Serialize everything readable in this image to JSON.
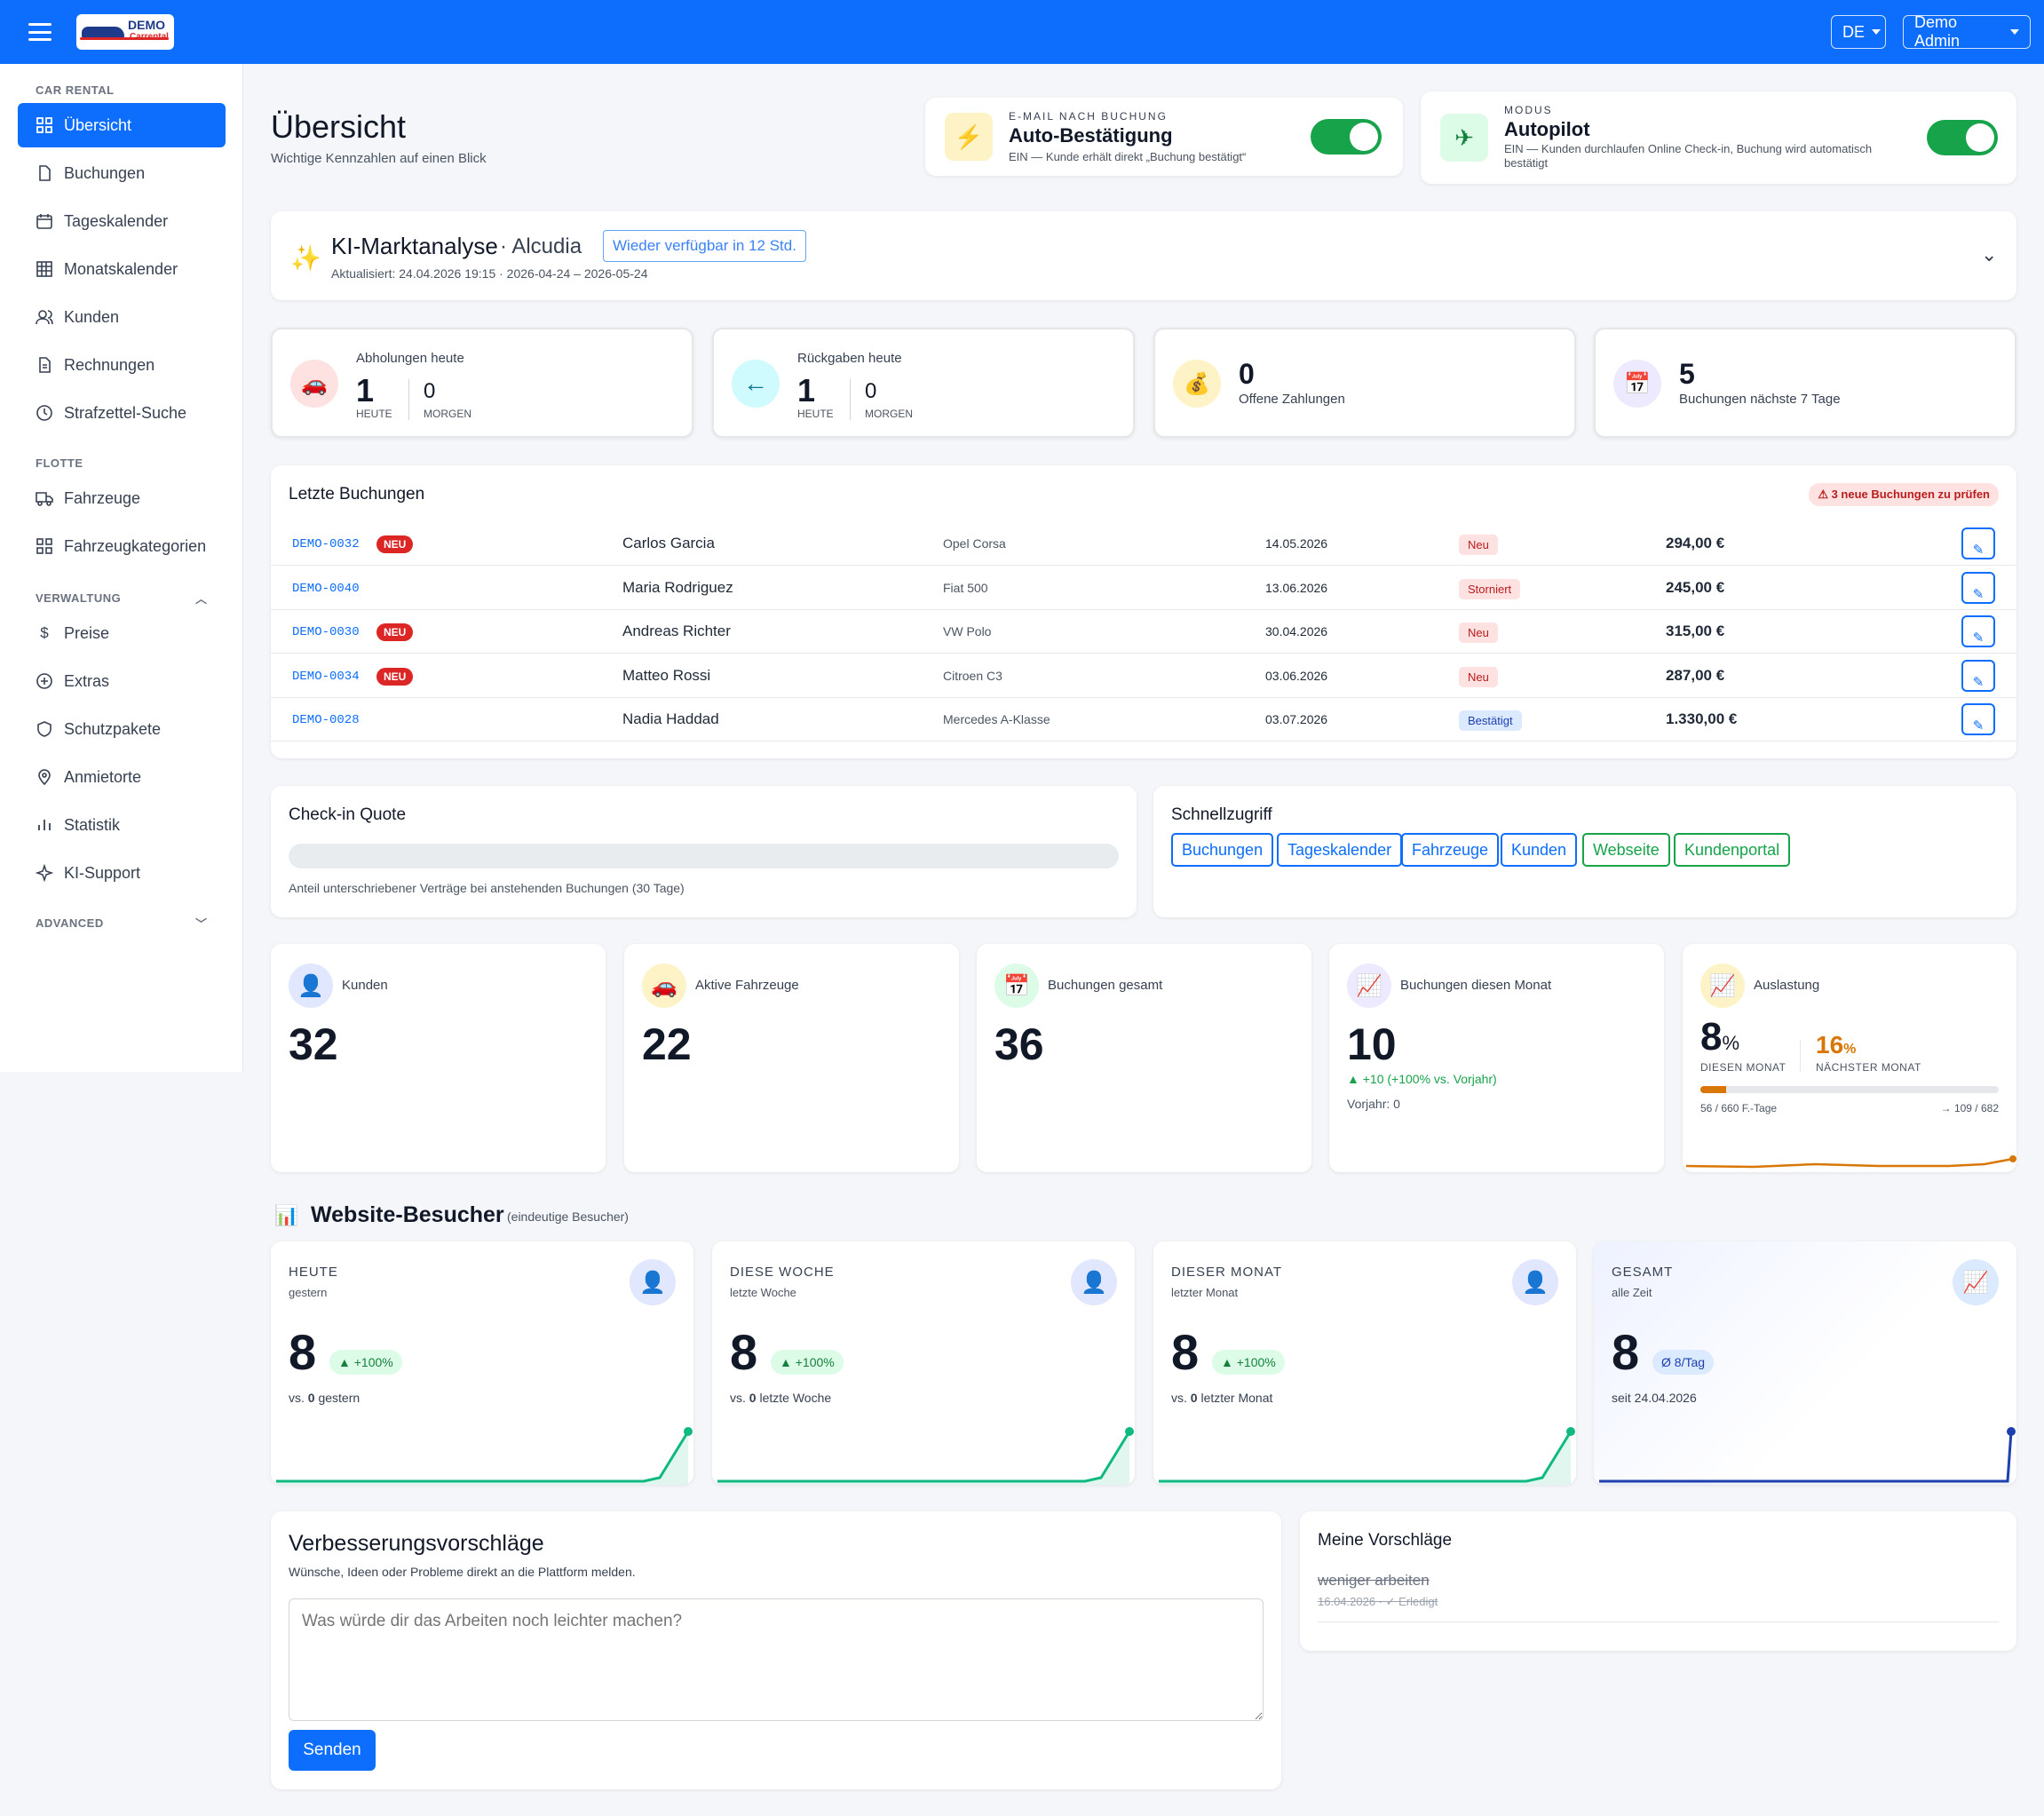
{
  "topbar": {
    "lang": "DE",
    "user": "Demo Admin",
    "logo_title": "DEMO",
    "logo_sub": "Carrental"
  },
  "sidebar": {
    "section_car_rental": "CAR RENTAL",
    "section_flotte": "FLOTTE",
    "section_verwaltung": "VERWALTUNG",
    "section_advanced": "ADVANCED",
    "items": [
      {
        "label": "Übersicht",
        "icon": "grid-icon"
      },
      {
        "label": "Buchungen",
        "icon": "file-icon"
      },
      {
        "label": "Tageskalender",
        "icon": "calendar-icon"
      },
      {
        "label": "Monatskalender",
        "icon": "table-icon"
      },
      {
        "label": "Kunden",
        "icon": "users-icon"
      },
      {
        "label": "Rechnungen",
        "icon": "invoice-icon"
      },
      {
        "label": "Strafzettel-Suche",
        "icon": "clock-icon"
      },
      {
        "label": "Fahrzeuge",
        "icon": "truck-icon"
      },
      {
        "label": "Fahrzeugkategorien",
        "icon": "grid-icon"
      },
      {
        "label": "Preise",
        "icon": "dollar-icon"
      },
      {
        "label": "Extras",
        "icon": "plus-circle-icon"
      },
      {
        "label": "Schutzpakete",
        "icon": "shield-icon"
      },
      {
        "label": "Anmietorte",
        "icon": "map-pin-icon"
      },
      {
        "label": "Statistik",
        "icon": "bar-chart-icon"
      },
      {
        "label": "KI-Support",
        "icon": "sparkle-icon"
      }
    ]
  },
  "header": {
    "title": "Übersicht",
    "subtitle": "Wichtige Kennzahlen auf einen Blick"
  },
  "auto_confirm": {
    "kicker": "E-MAIL NACH BUCHUNG",
    "title": "Auto-Bestätigung",
    "desc": "EIN — Kunde erhält direkt „Buchung bestätigt“",
    "enabled": true
  },
  "autopilot": {
    "kicker": "MODUS",
    "title": "Autopilot",
    "desc": "EIN — Kunden durchlaufen Online Check-in, Buchung wird automatisch bestätigt",
    "enabled": true
  },
  "ki": {
    "title": "KI-Marktanalyse",
    "location": "· Alcudia",
    "button": "Wieder verfügbar in 12 Std.",
    "updated": "Aktualisiert: 24.04.2026 19:15 · 2026-04-24 – 2026-05-24"
  },
  "stats": {
    "pickups": {
      "label": "Abholungen heute",
      "today": "1",
      "today_label": "HEUTE",
      "tomorrow": "0",
      "tomorrow_label": "MORGEN"
    },
    "returns": {
      "label": "Rückgaben heute",
      "today": "1",
      "today_label": "HEUTE",
      "tomorrow": "0",
      "tomorrow_label": "MORGEN"
    },
    "payments": {
      "value": "0",
      "label": "Offene Zahlungen"
    },
    "next7": {
      "value": "5",
      "label": "Buchungen nächste 7 Tage"
    }
  },
  "bookings": {
    "title": "Letzte Buchungen",
    "alert": "⚠ 3 neue Buchungen zu prüfen",
    "new_label": "NEU",
    "rows": [
      {
        "id": "DEMO-0032",
        "new": true,
        "customer": "Carlos Garcia",
        "car": "Opel Corsa",
        "date": "14.05.2026",
        "status": "Neu",
        "price": "294,00 €"
      },
      {
        "id": "DEMO-0040",
        "new": false,
        "customer": "Maria Rodriguez",
        "car": "Fiat 500",
        "date": "13.06.2026",
        "status": "Storniert",
        "price": "245,00 €"
      },
      {
        "id": "DEMO-0030",
        "new": true,
        "customer": "Andreas Richter",
        "car": "VW Polo",
        "date": "30.04.2026",
        "status": "Neu",
        "price": "315,00 €"
      },
      {
        "id": "DEMO-0034",
        "new": true,
        "customer": "Matteo Rossi",
        "car": "Citroen C3",
        "date": "03.06.2026",
        "status": "Neu",
        "price": "287,00 €"
      },
      {
        "id": "DEMO-0028",
        "new": false,
        "customer": "Nadia Haddad",
        "car": "Mercedes A-Klasse",
        "date": "03.07.2026",
        "status": "Bestätigt",
        "price": "1.330,00 €"
      }
    ]
  },
  "checkin": {
    "title": "Check-in Quote",
    "note": "Anteil unterschriebener Verträge bei anstehenden Buchungen (30 Tage)",
    "progress": 0
  },
  "quick": {
    "title": "Schnellzugriff",
    "links": [
      "Buchungen",
      "Tageskalender",
      "Fahrzeuge",
      "Kunden",
      "Webseite",
      "Kundenportal"
    ]
  },
  "kpis": {
    "customers": {
      "label": "Kunden",
      "value": "32"
    },
    "vehicles": {
      "label": "Aktive Fahrzeuge",
      "value": "22"
    },
    "bookings_total": {
      "label": "Buchungen gesamt",
      "value": "36"
    },
    "bookings_month": {
      "label": "Buchungen diesen Monat",
      "value": "10",
      "delta": "▲ +10 (+100% vs. Vorjahr)",
      "prev": "Vorjahr: 0"
    },
    "utilization": {
      "label": "Auslastung",
      "value": "8",
      "unit": "%",
      "value_label": "DIESEN MONAT",
      "next": "16",
      "next_unit": "%",
      "next_label": "NÄCHSTER MONAT",
      "days": "56 / 660 F.-Tage",
      "next_days": "→ 109 / 682",
      "progress": 0.085
    }
  },
  "visitors": {
    "title": "Website-Besucher",
    "subtitle": "(eindeutige Besucher)",
    "cards": [
      {
        "label": "HEUTE",
        "sub": "gestern",
        "value": "8",
        "badge": "▲ +100%",
        "vs_prefix": "vs.",
        "vs_value": "0",
        "vs_suffix": "gestern"
      },
      {
        "label": "DIESE WOCHE",
        "sub": "letzte Woche",
        "value": "8",
        "badge": "▲ +100%",
        "vs_prefix": "vs.",
        "vs_value": "0",
        "vs_suffix": "letzte Woche"
      },
      {
        "label": "DIESER MONAT",
        "sub": "letzter Monat",
        "value": "8",
        "badge": "▲ +100%",
        "vs_prefix": "vs.",
        "vs_value": "0",
        "vs_suffix": "letzter Monat"
      },
      {
        "label": "GESAMT",
        "sub": "alle Zeit",
        "value": "8",
        "badge": "Ø 8/Tag",
        "since": "seit 24.04.2026"
      }
    ]
  },
  "feedback": {
    "title": "Verbesserungsvorschläge",
    "subtitle": "Wünsche, Ideen oder Probleme direkt an die Plattform melden.",
    "placeholder": "Was würde dir das Arbeiten noch leichter machen?",
    "submit": "Senden"
  },
  "my_suggestions": {
    "title": "Meine Vorschläge",
    "items": [
      {
        "text": "weniger arbeiten",
        "meta": "16.04.2026 · ✓ Erledigt"
      }
    ]
  },
  "colors": {
    "primary": "#0d6efd",
    "success": "#16a34a",
    "danger": "#dc2626",
    "orange": "#d97706"
  }
}
